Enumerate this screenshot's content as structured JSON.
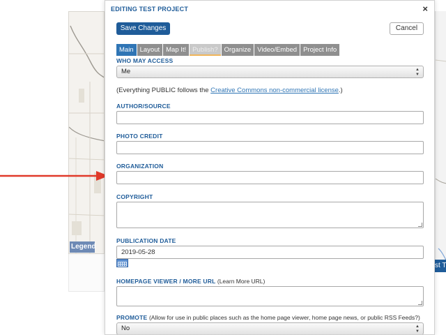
{
  "modal": {
    "title": "EDITING TEST PROJECT",
    "close_glyph": "×",
    "save_label": "Save Changes",
    "cancel_label": "Cancel"
  },
  "tabs": [
    {
      "label": "Main",
      "state": "active"
    },
    {
      "label": "Layout",
      "state": "normal"
    },
    {
      "label": "Map It!",
      "state": "normal"
    },
    {
      "label": "Publish?",
      "state": "dim"
    },
    {
      "label": "Organize",
      "state": "normal"
    },
    {
      "label": "Video/Embed",
      "state": "normal"
    },
    {
      "label": "Project Info",
      "state": "normal"
    }
  ],
  "access": {
    "label": "WHO MAY ACCESS",
    "value": "Me",
    "note_prefix": "(Everything PUBLIC follows the ",
    "note_link": "Creative Commons non-commercial license",
    "note_suffix": ".)"
  },
  "fields": {
    "author_label": "AUTHOR/SOURCE",
    "author_value": "",
    "photo_label": "PHOTO CREDIT",
    "photo_value": "",
    "org_label": "ORGANIZATION",
    "org_value": "",
    "copyright_label": "COPYRIGHT",
    "pubdate_label": "PUBLICATION DATE",
    "pubdate_value": "2019-05-28",
    "homepage_label": "HOMEPAGE VIEWER / MORE URL",
    "homepage_note": "(Learn More URL)",
    "promote_label": "PROMOTE",
    "promote_note": "(Allow for use in public places such as the home page viewer, home page news, or public RSS Feeds?)",
    "promote_value": "No"
  },
  "background": {
    "legend_label": "Legend",
    "right_tab_label": "st T"
  },
  "colors": {
    "accent": "#1f5c99",
    "tab_active": "#2f75b5",
    "tab_normal": "#8f8f8f",
    "arrow": "#e03a2a"
  },
  "icons": {
    "close": "close-icon",
    "calendar": "calendar-icon",
    "select_arrows": "updown-arrows-icon",
    "arrow": "red-arrow-icon"
  }
}
